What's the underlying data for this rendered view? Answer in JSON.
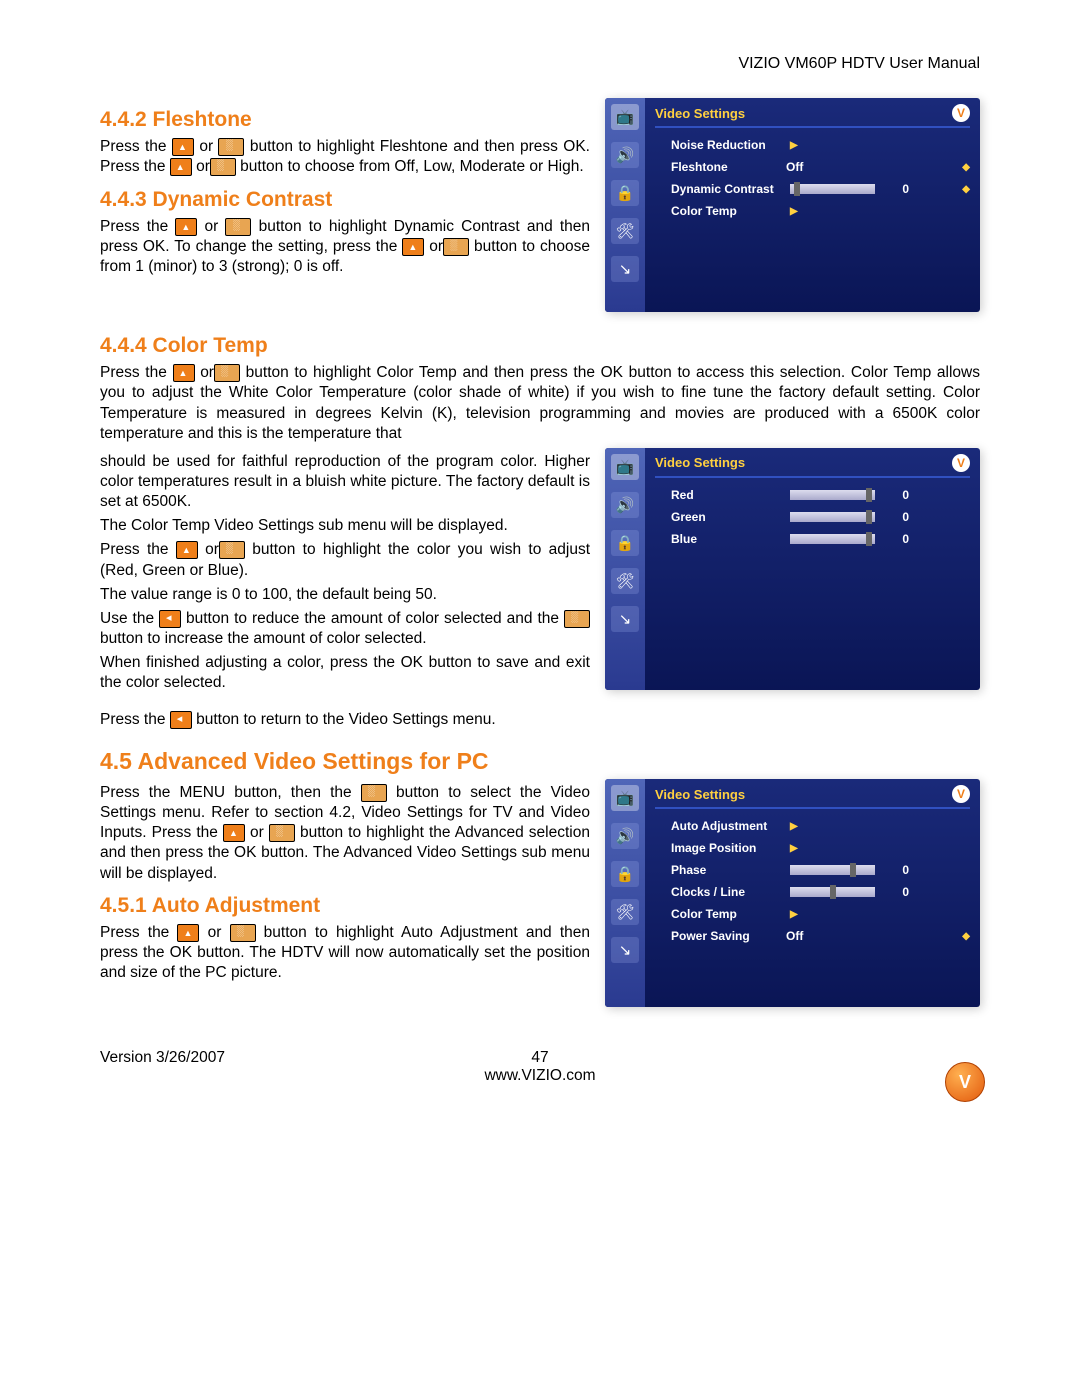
{
  "header": {
    "right": "VIZIO VM60P HDTV User Manual"
  },
  "sections": {
    "s442": {
      "title": "4.4.2   Fleshtone",
      "p1a": "Press the ",
      "p1b": " or ",
      "p1c": " button to highlight Fleshtone and then press OK.  Press the ",
      "p1d": " or",
      "p1e": " button to choose from Off, Low, Moderate or High."
    },
    "s443": {
      "title": "4.4.3   Dynamic Contrast",
      "p1a": "Press the ",
      "p1b": " or ",
      "p1c": " button to highlight Dynamic Contrast and then press OK.  To change the setting, press the ",
      "p1d": " or",
      "p1e": " button to choose from 1 (minor) to 3 (strong); 0 is off."
    },
    "s444": {
      "title": "4.4.4   Color Temp",
      "p1a": "Press the ",
      "p1b": " or",
      "p1c": " button to highlight Color Temp and then press the OK button to access this selection.  Color Temp allows you to adjust the White Color Temperature (color shade of white) if you wish to fine tune the factory default setting.  Color Temperature is measured in degrees Kelvin (K), television programming and movies are produced with a 6500K color temperature and this is the temperature that",
      "p2": "should be used for faithful reproduction of the program color.  Higher color temperatures result in a bluish white picture.  The factory default is set at 6500K.",
      "p3": "The Color Temp Video Settings sub menu will be displayed.",
      "p4a": "Press the ",
      "p4b": " or",
      "p4c": " button to highlight the color you wish to adjust (Red, Green or Blue).",
      "p5": "The value range is 0 to 100, the default being 50.",
      "p6a": "Use the ",
      "p6b": " button to reduce the amount of color selected and the ",
      "p6c": " button to increase the amount of color selected.",
      "p7": "When finished adjusting a color, press the OK button to save and exit the color selected.",
      "p8a": "Press the ",
      "p8b": " button to return to the Video Settings menu."
    },
    "s45": {
      "title": "4.5   Advanced Video Settings for PC",
      "p1a": "Press the MENU button, then the ",
      "p1b": " button to select the Video Settings menu.  Refer to section 4.2, Video Settings for TV and Video Inputs.  Press the ",
      "p1c": " or ",
      "p1d": " button to highlight the Advanced selection and then press the OK button.  The Advanced Video Settings sub menu will be displayed."
    },
    "s451": {
      "title": "4.5.1   Auto Adjustment",
      "p1a": "Press the ",
      "p1b": " or ",
      "p1c": " button to highlight Auto Adjustment and then press the OK button.  The HDTV will now automatically set the position and size of the PC picture."
    }
  },
  "osd": {
    "title": "Video Settings",
    "badge": "V",
    "menu1": {
      "r1": "Noise Reduction",
      "r2": "Fleshtone",
      "r2v": "Off",
      "r3": "Dynamic Contrast",
      "r3v": "0",
      "r4": "Color  Temp"
    },
    "menu2": {
      "r1": "Red",
      "r1v": "0",
      "r2": "Green",
      "r2v": "0",
      "r3": "Blue",
      "r3v": "0"
    },
    "menu3": {
      "r1": "Auto Adjustment",
      "r2": "Image Position",
      "r3": "Phase",
      "r3v": "0",
      "r4": "Clocks / Line",
      "r4v": "0",
      "r5": "Color  Temp",
      "r6": "Power Saving",
      "r6v": "Off"
    },
    "sidebar_icons": [
      "📺",
      "🔊",
      "🔒",
      "🛠",
      "↘"
    ]
  },
  "footer": {
    "version": "Version 3/26/2007",
    "page": "47",
    "url": "www.VIZIO.com",
    "logo": "V"
  }
}
